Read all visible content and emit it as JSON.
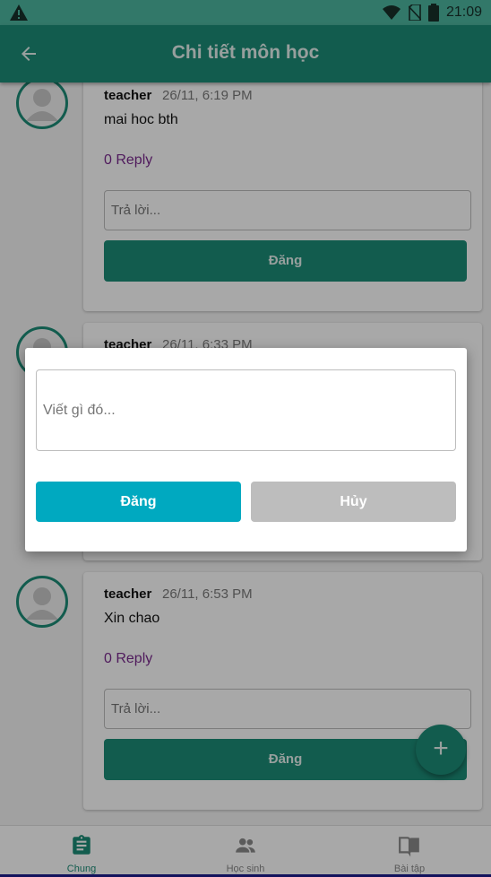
{
  "status_bar": {
    "time": "21:09",
    "icons": [
      "warning-icon",
      "wifi-icon",
      "no-sim-icon",
      "battery-icon"
    ]
  },
  "app_bar": {
    "title": "Chi tiết môn học",
    "back_icon": "arrow-back-icon"
  },
  "posts": [
    {
      "author": "teacher",
      "time": "26/11, 6:19 PM",
      "message": "mai hoc bth",
      "replies": "0 Reply",
      "reply_placeholder": "Trả lời...",
      "post_label": "Đăng"
    },
    {
      "author": "teacher",
      "time": "26/11, 6:33 PM"
    },
    {
      "author": "teacher",
      "time": "26/11, 6:53 PM",
      "message": "Xin chao",
      "replies": "0 Reply",
      "reply_placeholder": "Trả lời...",
      "post_label": "Đăng"
    }
  ],
  "fab": {
    "label": "+"
  },
  "bottom_nav": {
    "tabs": [
      {
        "label": "Chung",
        "icon": "clipboard-icon",
        "active": true
      },
      {
        "label": "Học sinh",
        "icon": "people-icon",
        "active": false
      },
      {
        "label": "Bài tập",
        "icon": "book-icon",
        "active": false
      }
    ]
  },
  "dialog": {
    "placeholder": "Viết gì đó...",
    "post_label": "Đăng",
    "cancel_label": "Hủy"
  },
  "colors": {
    "primary": "#1c8c77",
    "status_bar": "#4db6a0",
    "dialog_post": "#00a9c0",
    "dialog_cancel": "#bdbdbd",
    "reply_link": "#7a2a8e"
  }
}
